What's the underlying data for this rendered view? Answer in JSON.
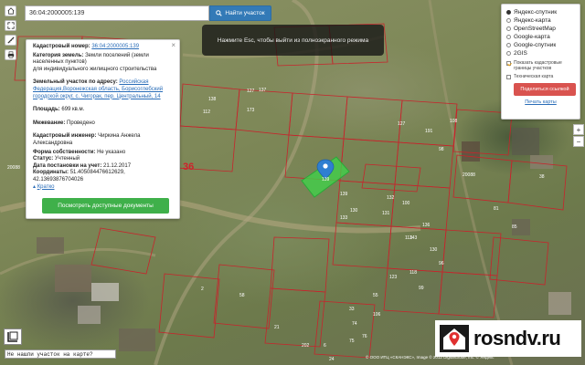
{
  "search": {
    "value": "36:04:2000005:139",
    "button_label": "Найти участок"
  },
  "fullscreen_hint": "Нажмите Esc, чтобы выйти из полноэкранного режима",
  "info": {
    "close": "×",
    "cadastral_label": "Кадастровый номер:",
    "cadastral_value": "36:04:2000005:139",
    "category_label": "Категория земель:",
    "category_value": "Земли поселений (земли населенных пунктов)",
    "usage_value": "для индивидуального жилищного строительства",
    "address_label": "Земельный участок по адресу:",
    "address_value": "Российская Федерация,Воронежская область, Борисоглебский городской округ, с. Чигорак, пер. Центральный, 14",
    "area_label": "Площадь:",
    "area_value": "699 кв.м.",
    "survey_label": "Межевание:",
    "survey_value": "Проведено",
    "engineer_label": "Кадастровый инженер:",
    "engineer_value": "Чиркина Анжела Александровна",
    "ownership_label": "Форма собственности:",
    "ownership_value": "Не указано",
    "status_label": "Статус:",
    "status_value": "Учтенный",
    "date_label": "Дата постановки на учет:",
    "date_value": "21.12.2017",
    "coords_label": "Координаты:",
    "coords_value": "51.405084476612629, 42.13693876704026",
    "collapse_link": "Кратко",
    "docs_button": "Посмотреть доступные документы"
  },
  "layers": {
    "options": [
      {
        "label": "Яндекс-спутник",
        "selected": true
      },
      {
        "label": "Яндекс-карта",
        "selected": false
      },
      {
        "label": "OpenStreetMap",
        "selected": false
      },
      {
        "label": "Google-карта",
        "selected": false
      },
      {
        "label": "Google-спутник",
        "selected": false
      },
      {
        "label": "2GIS",
        "selected": false
      }
    ],
    "show_borders": "Показать кадастровые границы участков",
    "technical_map": "Техническая карта",
    "share_button": "Поделиться ссылкой",
    "print_link": "Печать карты"
  },
  "map": {
    "big_label": "36",
    "parcel_numbers": [
      "137",
      "127",
      "138",
      "112",
      "173",
      "139",
      "133",
      "130",
      "132",
      "100",
      "131",
      "136",
      "113",
      "143",
      "130",
      "118",
      "96",
      "99",
      "55",
      "123",
      "33",
      "106",
      "74",
      "76",
      "75",
      "2",
      "58",
      "21",
      "202",
      "6",
      "24",
      "127",
      "191",
      "108",
      "98",
      "81",
      "85",
      "38"
    ],
    "pin_label": "139"
  },
  "zoom": {
    "plus": "+",
    "minus": "−"
  },
  "bottom": {
    "not_found": "Не нашли участок на карте?",
    "copyright": "© ООО ИТЦ «СКАНЭКС», Image © 2012 DigitalGlobe, Inc. © Яндекс"
  },
  "watermark": {
    "text": "rosndv.ru"
  },
  "colors": {
    "accent": "#337ab7",
    "green": "#3fb04a",
    "red": "#d9534f",
    "parcel": "#c7242c"
  }
}
